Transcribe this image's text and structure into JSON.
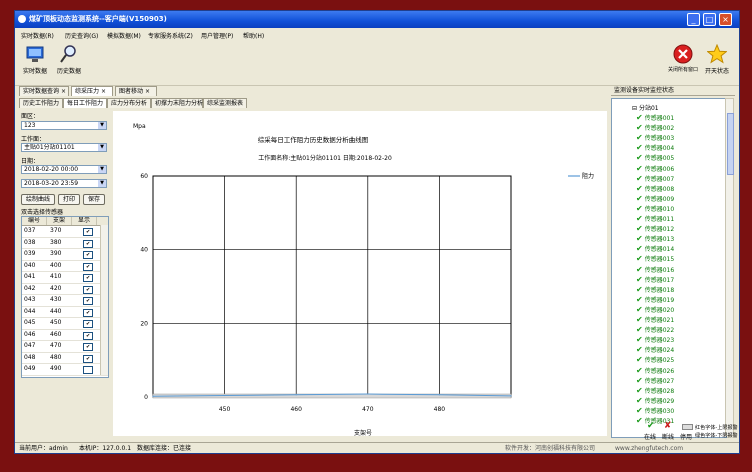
{
  "window": {
    "title": "煤矿顶板动态监测系统--客户端(V150903)"
  },
  "menu": [
    "实时数据(R)",
    "历史查询(G)",
    "模拟数据(M)",
    "专家服务系统(Z)",
    "用户管理(P)",
    "帮助(H)"
  ],
  "toolbar": {
    "realtime_label": "实时数据",
    "history_label": "历史数据",
    "close_all_label": "关闭所有窗口",
    "sky_label": "开天状态"
  },
  "tabs_top": [
    "实时数据查询",
    "综采压力",
    "图者移动"
  ],
  "tabs_sub": [
    "历史工作阻力",
    "每日工作阻力",
    "应力分布分析",
    "初撑力末阻力分析",
    "综采监测报表"
  ],
  "left": {
    "area_label": "面区：",
    "area_value": "123",
    "face_label": "工作面：",
    "face_value": "主贴01分站01101",
    "date_label": "日期：",
    "date_start": "2018-02-20 00:00",
    "date_end": "2018-03-20 23:59",
    "btn_draw": "绘制曲线",
    "btn_print": "打印",
    "btn_save": "保存",
    "sensor_label": "双击选择传感器",
    "table_headers": [
      "编号",
      "支架",
      "显示"
    ],
    "rows": [
      {
        "id": "037",
        "support": "370",
        "checked": true
      },
      {
        "id": "038",
        "support": "380",
        "checked": true
      },
      {
        "id": "039",
        "support": "390",
        "checked": true
      },
      {
        "id": "040",
        "support": "400",
        "checked": true
      },
      {
        "id": "041",
        "support": "410",
        "checked": true
      },
      {
        "id": "042",
        "support": "420",
        "checked": true
      },
      {
        "id": "043",
        "support": "430",
        "checked": true
      },
      {
        "id": "044",
        "support": "440",
        "checked": true
      },
      {
        "id": "045",
        "support": "450",
        "checked": true
      },
      {
        "id": "046",
        "support": "460",
        "checked": true
      },
      {
        "id": "047",
        "support": "470",
        "checked": true
      },
      {
        "id": "048",
        "support": "480",
        "checked": true
      },
      {
        "id": "049",
        "support": "490",
        "checked": false
      }
    ]
  },
  "chart_data": {
    "type": "line",
    "title": "综采每日工作阻力历史数据分析曲线图",
    "subtitle": "工作面名称:主贴01分站01101  日期:2018-02-20",
    "ylabel": "Mpa",
    "xlabel": "支架号",
    "ylim": [
      0,
      60
    ],
    "yticks": [
      0,
      20,
      40,
      60
    ],
    "xlim": [
      440,
      490
    ],
    "xticks": [
      450,
      460,
      470,
      480
    ],
    "grid": true,
    "legend": "top-right",
    "series": [
      {
        "name": "阻力",
        "color": "#5b9bd5",
        "x": [
          440,
          450,
          460,
          470,
          480,
          490
        ],
        "y": [
          0.2,
          0.4,
          0.6,
          0.8,
          0.6,
          0.3
        ]
      }
    ]
  },
  "right": {
    "title": "监测设备实时监控状态",
    "root": "分站01",
    "sensors": [
      "传感器001",
      "传感器002",
      "传感器003",
      "传感器004",
      "传感器005",
      "传感器006",
      "传感器007",
      "传感器008",
      "传感器009",
      "传感器010",
      "传感器011",
      "传感器012",
      "传感器013",
      "传感器014",
      "传感器015",
      "传感器016",
      "传感器017",
      "传感器018",
      "传感器019",
      "传感器020",
      "传感器021",
      "传感器022",
      "传感器023",
      "传感器024",
      "传感器025",
      "传感器026",
      "传感器027",
      "传感器028",
      "传感器029",
      "传感器030",
      "传感器031"
    ],
    "legend_online": "在线",
    "legend_offline": "断线",
    "legend_disabled": "停用",
    "legend_red": "红色字体-上限报警",
    "legend_green": "绿色字体-下限报警"
  },
  "status": {
    "user": "当前用户：admin",
    "local": "本机IP：127.0.0.1",
    "db": "数据库连接：已连接",
    "company": "软件开发：河南创福科技有限公司",
    "site": "www.zhengfutech.com"
  },
  "colors": {
    "title_bar": "#1050d8",
    "accent": "#0a7a0a",
    "frame_bg": "#7a1010"
  }
}
